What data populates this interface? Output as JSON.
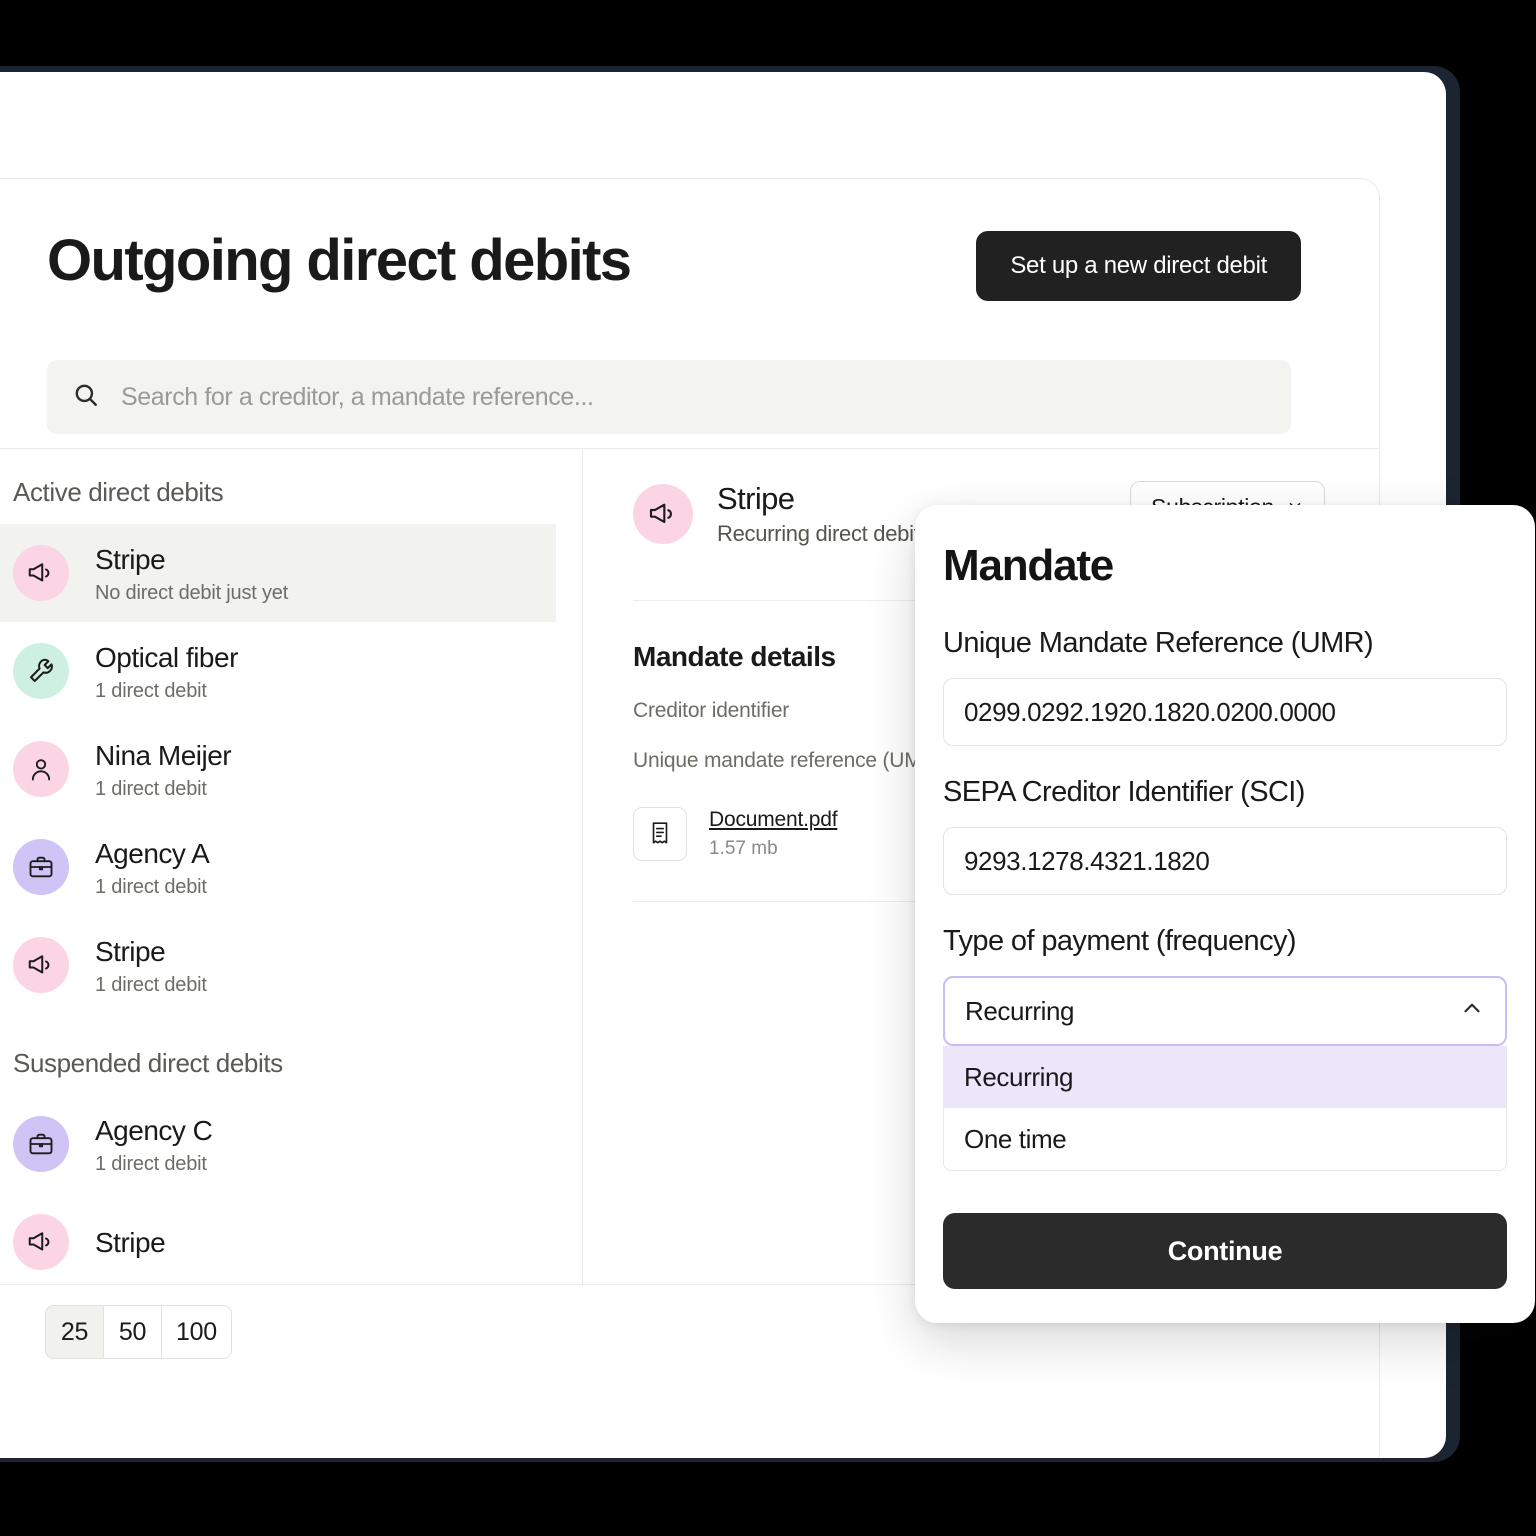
{
  "header": {
    "title": "Outgoing direct debits",
    "cta_label": "Set up a new direct debit",
    "search_placeholder": "Search for a creditor, a mandate reference...",
    "search_value": ""
  },
  "sidebar": {
    "groups": [
      {
        "title": "Active direct debits",
        "items": [
          {
            "name": "Stripe",
            "sub": "No direct debit just yet",
            "icon": "megaphone-icon",
            "color": "#fbd5e4",
            "selected": true
          },
          {
            "name": "Optical fiber",
            "sub": "1 direct debit",
            "icon": "wrench-icon",
            "color": "#cdf0e1",
            "selected": false
          },
          {
            "name": "Nina Meijer",
            "sub": "1 direct debit",
            "icon": "person-icon",
            "color": "#fbd5e4",
            "selected": false
          },
          {
            "name": "Agency A",
            "sub": "1 direct debit",
            "icon": "briefcase-icon",
            "color": "#cfc4f5",
            "selected": false
          },
          {
            "name": "Stripe",
            "sub": "1 direct debit",
            "icon": "megaphone-icon",
            "color": "#fbd5e4",
            "selected": false
          }
        ]
      },
      {
        "title": "Suspended direct debits",
        "items": [
          {
            "name": "Agency C",
            "sub": "1 direct debit",
            "icon": "briefcase-icon",
            "color": "#cfc4f5",
            "selected": false
          },
          {
            "name": "Stripe",
            "sub": "",
            "icon": "megaphone-icon",
            "color": "#fbd5e4",
            "selected": false
          }
        ]
      }
    ]
  },
  "detail": {
    "name": "Stripe",
    "subtitle": "Recurring direct debits",
    "icon": "megaphone-icon",
    "icon_color": "#fbd5e4",
    "chip_label": "Subscription",
    "section_title": "Mandate details",
    "rows": [
      "Creditor identifier",
      "Unique mandate reference (UMR)"
    ],
    "file": {
      "name": "Document.pdf",
      "size": "1.57 mb",
      "icon": "document-icon"
    }
  },
  "pagination": {
    "options": [
      "25",
      "50",
      "100"
    ],
    "selected": "25"
  },
  "modal": {
    "title": "Mandate",
    "umr_label": "Unique Mandate Reference (UMR)",
    "umr_value": "0299.0292.1920.1820.0200.0000",
    "sci_label": "SEPA Creditor Identifier (SCI)",
    "sci_value": "9293.1278.4321.1820",
    "frequency_label": "Type of payment (frequency)",
    "frequency_selected": "Recurring",
    "frequency_options": [
      "Recurring",
      "One time"
    ],
    "frequency_highlighted": "Recurring",
    "continue_label": "Continue",
    "accent_color": "#c9bdf6"
  }
}
